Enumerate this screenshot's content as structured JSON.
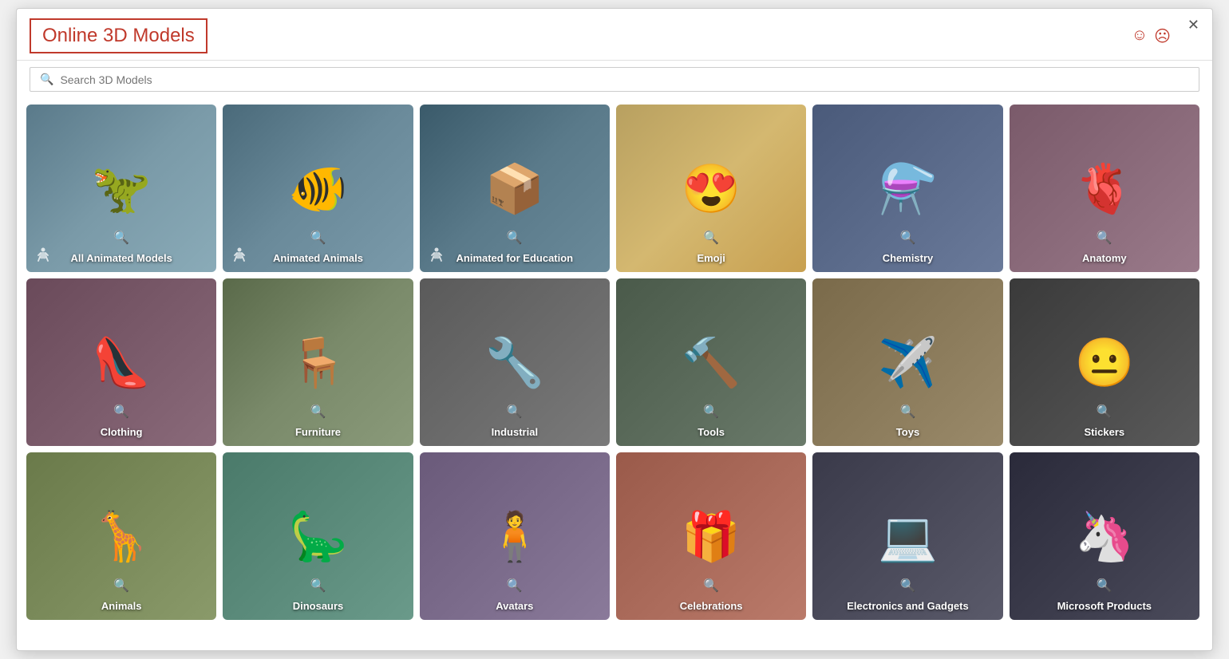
{
  "window": {
    "title": "Online 3D Models",
    "close_label": "✕"
  },
  "feedback": {
    "positive_icon": "☺",
    "negative_icon": "☹"
  },
  "search": {
    "placeholder": "Search 3D Models"
  },
  "categories": [
    {
      "id": "all-animated",
      "label": "All Animated Models",
      "bg_class": "bg-animated-models",
      "emoji": "🦖",
      "has_anim": true
    },
    {
      "id": "animated-animals",
      "label": "Animated Animals",
      "bg_class": "bg-animated-animals",
      "emoji": "🐠",
      "has_anim": true
    },
    {
      "id": "animated-edu",
      "label": "Animated for Education",
      "bg_class": "bg-animated-edu",
      "emoji": "📦",
      "has_anim": true
    },
    {
      "id": "emoji",
      "label": "Emoji",
      "bg_class": "bg-emoji",
      "emoji": "😍",
      "has_anim": false
    },
    {
      "id": "chemistry",
      "label": "Chemistry",
      "bg_class": "bg-chemistry",
      "emoji": "⚗️",
      "has_anim": false
    },
    {
      "id": "anatomy",
      "label": "Anatomy",
      "bg_class": "bg-anatomy",
      "emoji": "🫀",
      "has_anim": false
    },
    {
      "id": "clothing",
      "label": "Clothing",
      "bg_class": "bg-clothing",
      "emoji": "👠",
      "has_anim": false
    },
    {
      "id": "furniture",
      "label": "Furniture",
      "bg_class": "bg-furniture",
      "emoji": "🪑",
      "has_anim": false
    },
    {
      "id": "industrial",
      "label": "Industrial",
      "bg_class": "bg-industrial",
      "emoji": "🔧",
      "has_anim": false
    },
    {
      "id": "tools",
      "label": "Tools",
      "bg_class": "bg-tools",
      "emoji": "🔨",
      "has_anim": false
    },
    {
      "id": "toys",
      "label": "Toys",
      "bg_class": "bg-toys",
      "emoji": "✈️",
      "has_anim": false
    },
    {
      "id": "stickers",
      "label": "Stickers",
      "bg_class": "bg-stickers",
      "emoji": "😐",
      "has_anim": false
    },
    {
      "id": "animals",
      "label": "Animals",
      "bg_class": "bg-animals",
      "emoji": "🦒",
      "has_anim": false
    },
    {
      "id": "dinosaurs",
      "label": "Dinosaurs",
      "bg_class": "bg-dinosaurs",
      "emoji": "🦕",
      "has_anim": false
    },
    {
      "id": "avatars",
      "label": "Avatars",
      "bg_class": "bg-avatars",
      "emoji": "🧍",
      "has_anim": false
    },
    {
      "id": "celebrations",
      "label": "Celebrations",
      "bg_class": "bg-celebrations",
      "emoji": "🎁",
      "has_anim": false
    },
    {
      "id": "electronics",
      "label": "Electronics and Gadgets",
      "bg_class": "bg-electronics",
      "emoji": "💻",
      "has_anim": false
    },
    {
      "id": "microsoft",
      "label": "Microsoft Products",
      "bg_class": "bg-microsoft",
      "emoji": "🦄",
      "has_anim": false
    }
  ],
  "search_icon": "🔍",
  "anim_icon": "🏃"
}
